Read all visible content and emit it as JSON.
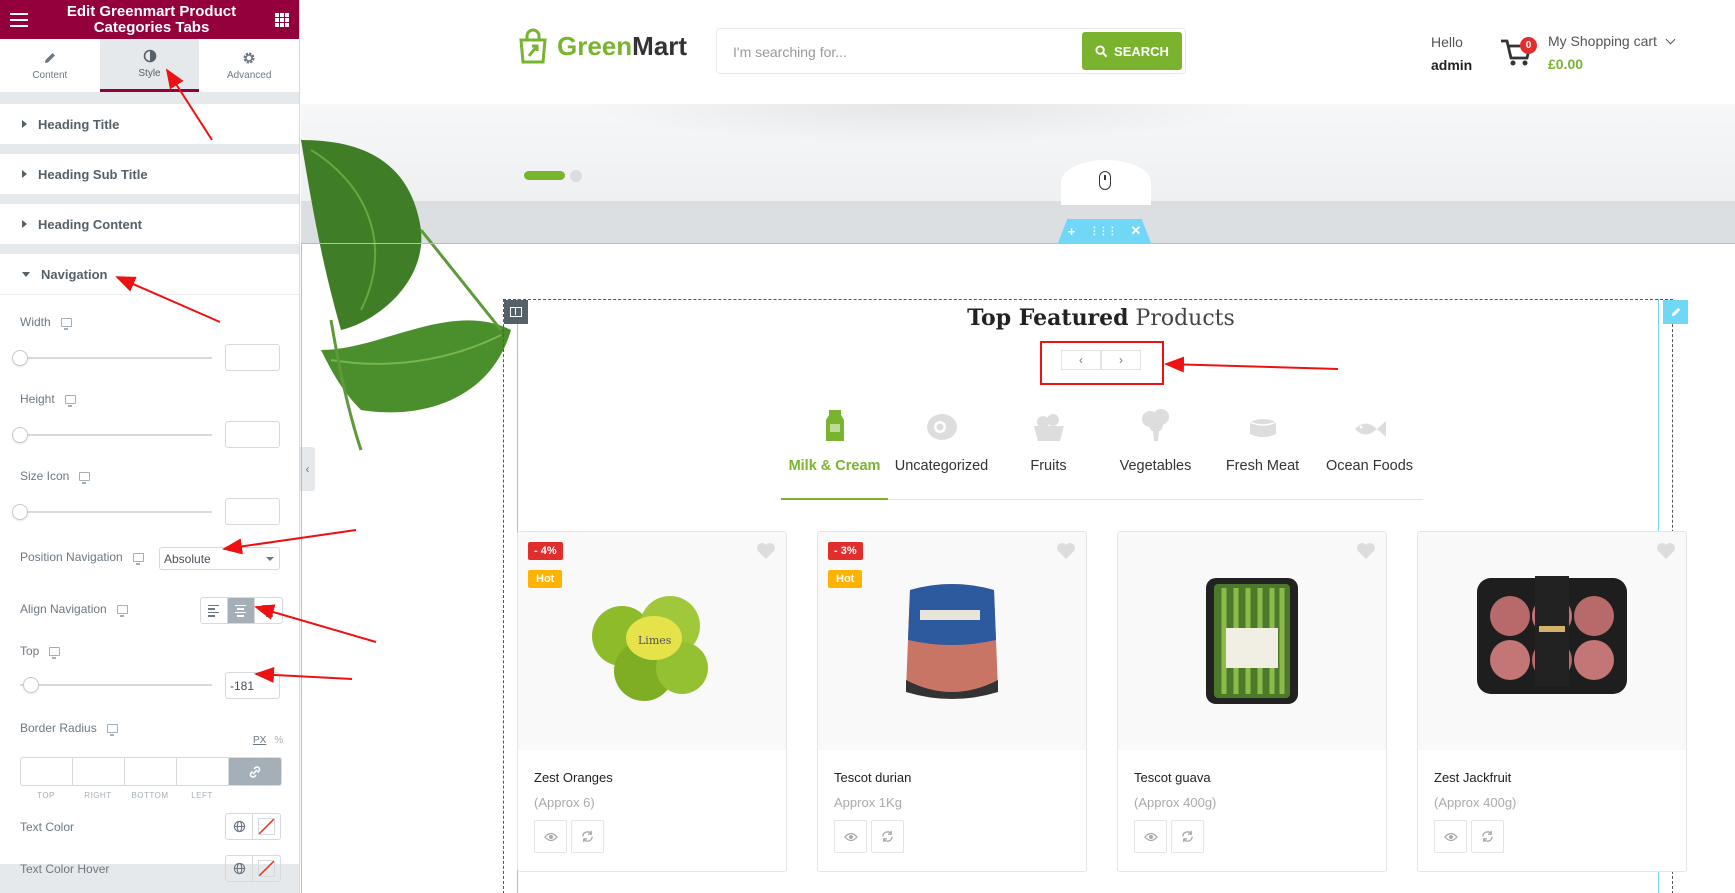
{
  "panel": {
    "title": "Edit Greenmart Product Categories Tabs",
    "tabs": [
      {
        "label": "Content",
        "icon": "pencil-icon"
      },
      {
        "label": "Style",
        "icon": "contrast-icon"
      },
      {
        "label": "Advanced",
        "icon": "gear-icon"
      }
    ],
    "sections": {
      "heading_title": "Heading Title",
      "heading_sub_title": "Heading Sub Title",
      "heading_content": "Heading Content",
      "navigation": "Navigation"
    },
    "controls": {
      "width": "Width",
      "height": "Height",
      "size_icon": "Size Icon",
      "position_navigation": "Position Navigation",
      "position_value": "Absolute",
      "align_navigation": "Align Navigation",
      "top": "Top",
      "top_value": "-181",
      "border_radius": "Border Radius",
      "unit_px": "PX",
      "unit_pct": "%",
      "dim_top": "TOP",
      "dim_right": "RIGHT",
      "dim_bottom": "BOTTOM",
      "dim_left": "LEFT",
      "text_color": "Text Color",
      "text_color_hover": "Text Color Hover"
    }
  },
  "header": {
    "logo_green": "Green",
    "logo_dark": "Mart",
    "search_placeholder": "I'm searching for...",
    "search_button": "SEARCH",
    "hello": "Hello",
    "username": "admin",
    "cart_count": "0",
    "cart_label": "My Shopping cart",
    "cart_total": "£0.00"
  },
  "section": {
    "heading_bold": "Top Featured",
    "heading_light": "Products",
    "nav_prev": "‹",
    "nav_next": "›",
    "categories": [
      {
        "label": "Milk & Cream",
        "icon": "milk-carton-icon",
        "active": true
      },
      {
        "label": "Uncategorized",
        "icon": "egg-icon",
        "active": false
      },
      {
        "label": "Fruits",
        "icon": "fruit-basket-icon",
        "active": false
      },
      {
        "label": "Vegetables",
        "icon": "broccoli-icon",
        "active": false
      },
      {
        "label": "Fresh Meat",
        "icon": "meat-icon",
        "active": false
      },
      {
        "label": "Ocean Foods",
        "icon": "fish-icon",
        "active": false
      }
    ],
    "products": [
      {
        "name": "Zest Oranges",
        "weight": "(Approx 6)",
        "sale": "- 4%",
        "hot": "Hot"
      },
      {
        "name": "Tescot durian",
        "weight": "Approx 1Kg",
        "sale": "- 3%",
        "hot": "Hot"
      },
      {
        "name": "Tescot guava",
        "weight": "(Approx 400g)"
      },
      {
        "name": "Zest Jackfruit",
        "weight": "(Approx 400g)"
      }
    ]
  },
  "colors": {
    "brand_green": "#7ab42f",
    "elementor_maroon": "#93003c",
    "editor_cyan": "#71d7f7",
    "annotation_red": "#e11111"
  }
}
